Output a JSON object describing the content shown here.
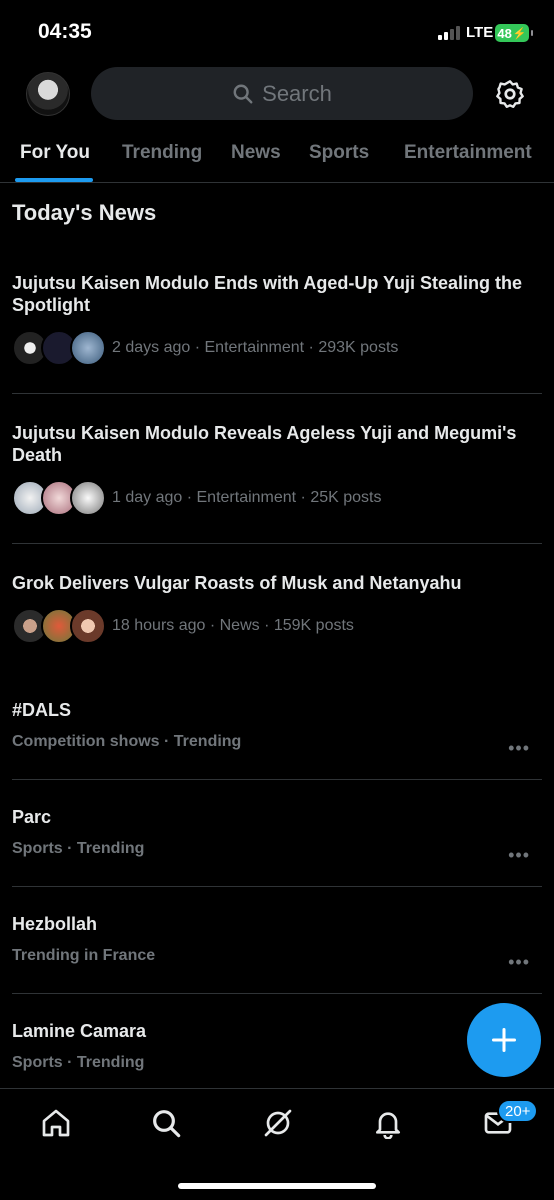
{
  "status_bar": {
    "time": "04:35",
    "network": "LTE",
    "battery": "48"
  },
  "header": {
    "search_placeholder": "Search"
  },
  "tabs": [
    {
      "label": "For You",
      "active": true
    },
    {
      "label": "Trending",
      "active": false
    },
    {
      "label": "News",
      "active": false
    },
    {
      "label": "Sports",
      "active": false
    },
    {
      "label": "Entertainment",
      "active": false
    }
  ],
  "section": {
    "title": "Today's News"
  },
  "news": [
    {
      "title": "Jujutsu Kaisen Modulo Ends with Aged-Up Yuji Stealing the Spotlight",
      "meta": "2 days ago · Entertainment · 293K posts"
    },
    {
      "title": "Jujutsu Kaisen Modulo Reveals Ageless Yuji and Megumi's Death",
      "meta": "1 day ago · Entertainment · 25K posts"
    },
    {
      "title": "Grok Delivers Vulgar Roasts of Musk and Netanyahu",
      "meta": "18 hours ago · News · 159K posts"
    }
  ],
  "trends": [
    {
      "title": "#DALS",
      "subtitle": "Competition shows · Trending"
    },
    {
      "title": "Parc",
      "subtitle": "Sports · Trending"
    },
    {
      "title": "Hezbollah",
      "subtitle": "Trending in France"
    },
    {
      "title": "Lamine Camara",
      "subtitle": "Sports · Trending"
    }
  ],
  "bottom_nav": {
    "messages_badge": "20+"
  },
  "icons": [
    "search-icon",
    "gear-icon",
    "home-icon",
    "explore-icon",
    "grok-icon",
    "bell-icon",
    "mail-icon",
    "plus-icon"
  ],
  "colors": {
    "accent": "#1d9bf0",
    "background": "#000000",
    "muted": "#71767b",
    "battery": "#34c759"
  }
}
